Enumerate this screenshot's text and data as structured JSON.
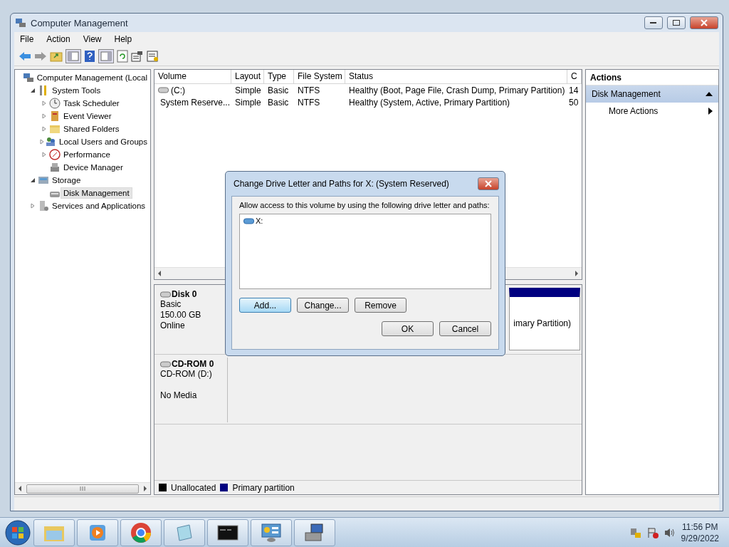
{
  "window": {
    "title": "Computer Management"
  },
  "menu": [
    "File",
    "Action",
    "View",
    "Help"
  ],
  "tree": [
    {
      "label": "Computer Management (Local",
      "selected": false,
      "children": [
        {
          "label": "System Tools",
          "expanded": true,
          "selected": false,
          "children": [
            {
              "label": "Task Scheduler",
              "expanded": false,
              "selected": false
            },
            {
              "label": "Event Viewer",
              "expanded": false,
              "selected": false
            },
            {
              "label": "Shared Folders",
              "expanded": false,
              "selected": false
            },
            {
              "label": "Local Users and Groups",
              "expanded": false,
              "selected": false
            },
            {
              "label": "Performance",
              "expanded": false,
              "selected": false
            },
            {
              "label": "Device Manager",
              "selected": false
            }
          ]
        },
        {
          "label": "Storage",
          "expanded": true,
          "selected": false,
          "children": [
            {
              "label": "Disk Management",
              "selected": true
            }
          ]
        },
        {
          "label": "Services and Applications",
          "expanded": false,
          "selected": false
        }
      ]
    }
  ],
  "volumes": {
    "columns": [
      "Volume",
      "Layout",
      "Type",
      "File System",
      "Status",
      "C"
    ],
    "rows": [
      [
        "(C:)",
        "Simple",
        "Basic",
        "NTFS",
        "Healthy (Boot, Page File, Crash Dump, Primary Partition)",
        "14"
      ],
      [
        "System Reserve...",
        "Simple",
        "Basic",
        "NTFS",
        "Healthy (System, Active, Primary Partition)",
        "50"
      ]
    ]
  },
  "disks": [
    {
      "name": "Disk 0",
      "type": "Basic",
      "size": "150.00 GB",
      "status": "Online",
      "partition": "imary Partition)"
    },
    {
      "name": "CD-ROM 0",
      "type": "CD-ROM (D:)",
      "status": "No Media"
    }
  ],
  "legend": [
    {
      "label": "Unallocated",
      "color": "#000000"
    },
    {
      "label": "Primary partition",
      "color": "#000080"
    }
  ],
  "actions": {
    "title": "Actions",
    "section": {
      "label": "Disk Management",
      "expanded": true
    },
    "items": [
      "More Actions"
    ]
  },
  "dialog": {
    "title": "Change Drive Letter and Paths for X: (System Reserved)",
    "prompt": "Allow access to this volume by using the following drive letter and paths:",
    "paths": [
      "X:"
    ],
    "buttons": [
      {
        "label": "Add...",
        "focused": true
      },
      {
        "label": "Change...",
        "focused": false
      },
      {
        "label": "Remove",
        "focused": false
      }
    ],
    "footer_buttons": [
      {
        "label": "OK",
        "focused": false
      },
      {
        "label": "Cancel",
        "focused": false
      }
    ]
  },
  "taskbar": {
    "time": "11:56 PM",
    "date": "9/29/2022"
  }
}
